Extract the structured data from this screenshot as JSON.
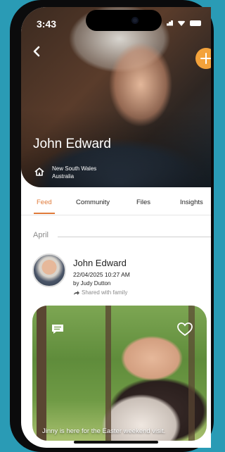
{
  "status_bar": {
    "time": "3:43"
  },
  "profile": {
    "name": "John Edward",
    "location_line1": "New South Wales",
    "location_line2": "Australia"
  },
  "tabs": [
    {
      "label": "Feed",
      "active": true
    },
    {
      "label": "Community",
      "active": false
    },
    {
      "label": "Files",
      "active": false
    },
    {
      "label": "Insights",
      "active": false
    }
  ],
  "section_label": "April",
  "post": {
    "author": "John Edward",
    "datetime": "22/04/2025 10:27 AM",
    "by_line": "by Judy  Dutton",
    "shared_label": "Shared with family",
    "caption": "Jinny is here for the Easter weekend visit."
  },
  "colors": {
    "accent": "#e07b3a",
    "add_button": "#f3a23b",
    "background": "#2a9bb5"
  },
  "icons": {
    "back": "back-chevron-icon",
    "add": "plus-icon",
    "location": "home-icon",
    "share": "share-arrow-icon",
    "comment": "comment-icon",
    "like": "heart-icon"
  }
}
